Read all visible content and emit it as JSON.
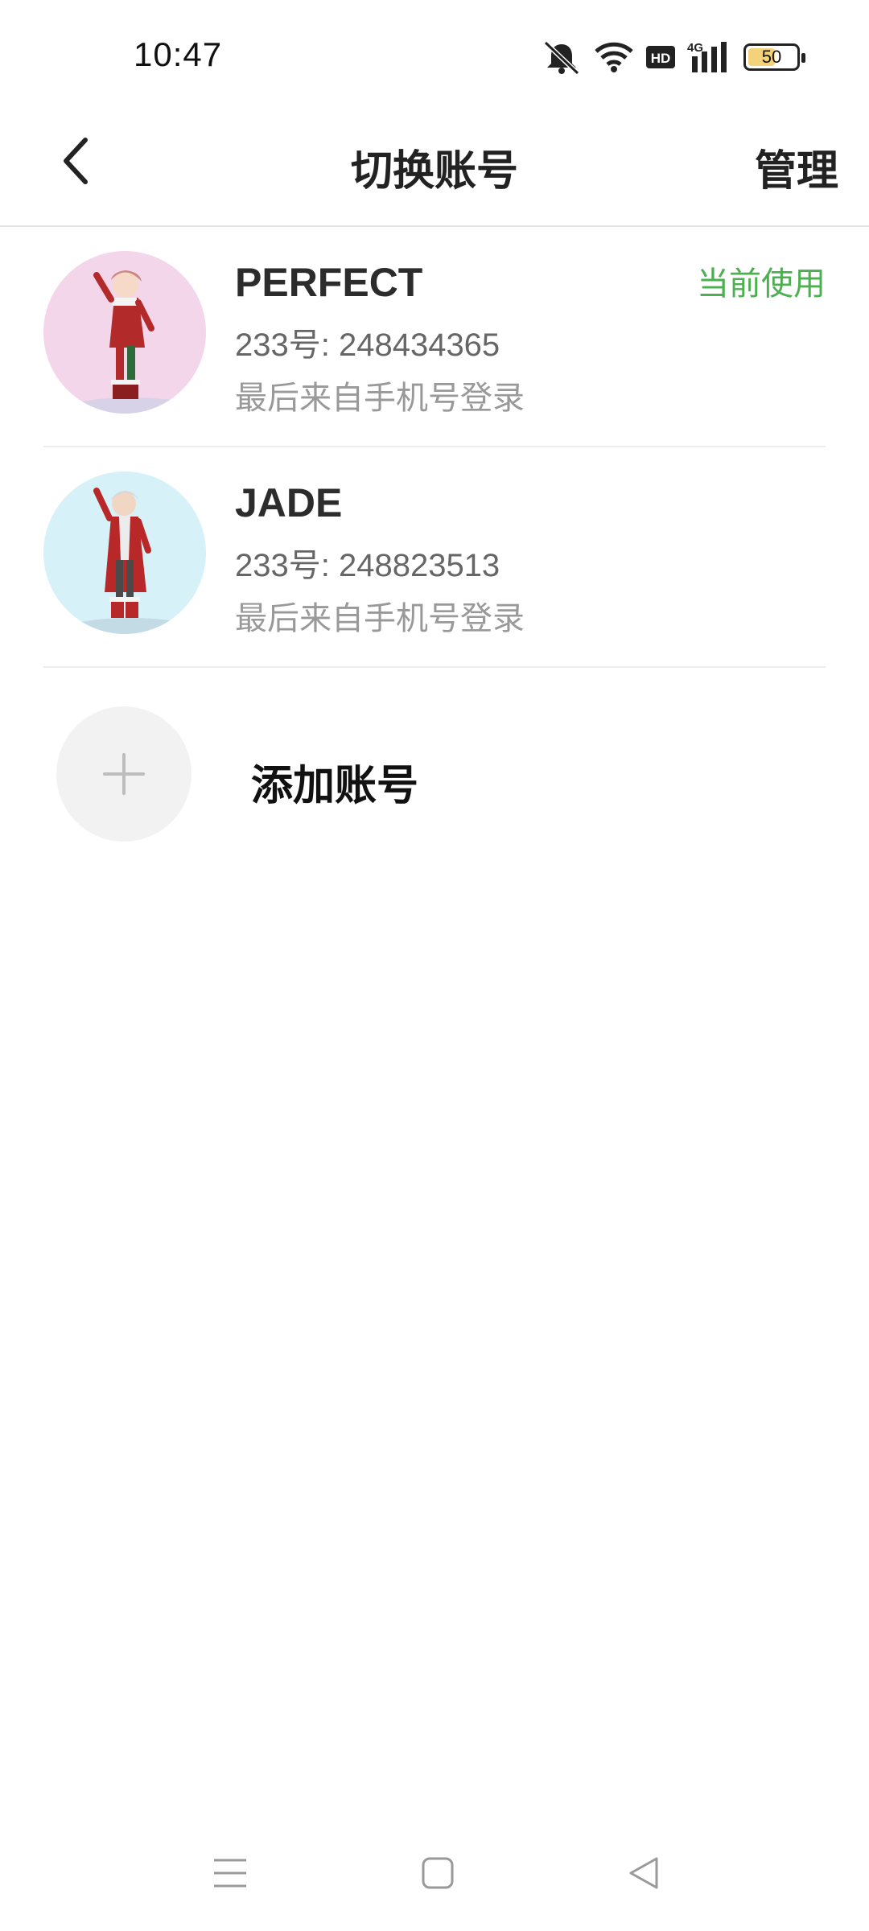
{
  "status_bar": {
    "time": "10:47",
    "battery_level": "50",
    "icons": [
      "mute-bell-icon",
      "wifi-icon",
      "hd-icon",
      "signal-4g-icon",
      "battery-icon"
    ]
  },
  "header": {
    "title": "切换账号",
    "manage_label": "管理",
    "back_icon": "chevron-left-icon"
  },
  "accounts": [
    {
      "name": "PERFECT",
      "id_text": "233号: 248434365",
      "login_text": "最后来自手机号登录",
      "badge": "当前使用",
      "avatar_bg": "#f3d6ea"
    },
    {
      "name": "JADE",
      "id_text": "233号: 248823513",
      "login_text": "最后来自手机号登录",
      "badge": "",
      "avatar_bg": "#d6f1f8"
    }
  ],
  "add_account": {
    "label": "添加账号",
    "icon": "plus-icon"
  },
  "nav_bar": {
    "icons": [
      "menu-icon",
      "home-square-icon",
      "back-triangle-icon"
    ]
  },
  "colors": {
    "accent_green": "#4caf50",
    "divider": "#ececec"
  }
}
